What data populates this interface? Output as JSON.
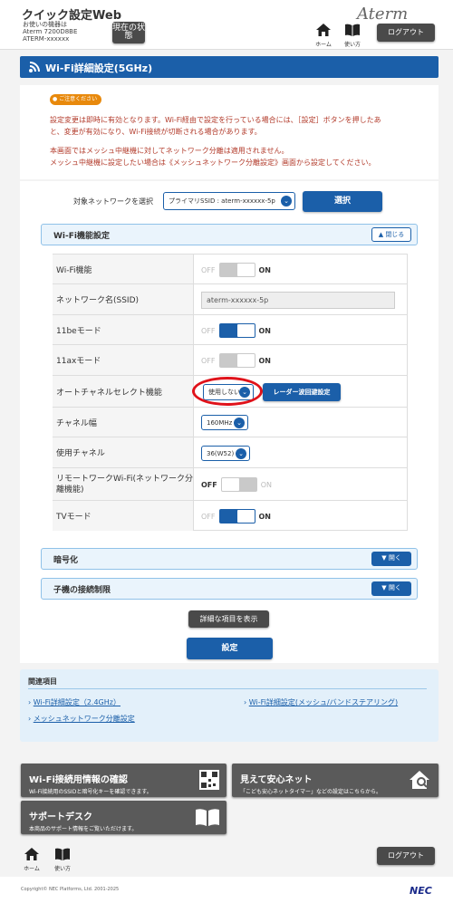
{
  "header": {
    "app_title": "クイック設定Web",
    "device_line1": "お使いの機器は",
    "device_line2": "Aterm 7200D8BE",
    "device_line3": "ATERM-xxxxxx",
    "status_btn": "現在の状態",
    "home_label": "ホーム",
    "howto_label": "使い方",
    "logout_label": "ログアウト",
    "brand": "Aterm"
  },
  "page_title": "Wi-Fi詳細設定(5GHz)",
  "notice": {
    "badge": "ご注意ください",
    "line1": "設定変更は即時に有効となります。Wi-Fi経由で設定を行っている場合には、［設定］ボタンを押したあ",
    "line2": "と、変更が有効になり、Wi-Fi接続が切断される場合があります。",
    "line3": "本画面ではメッシュ中継機に対してネットワーク分離は適用されません。",
    "line4": "メッシュ中継機に設定したい場合は《メッシュネットワーク分離設定》画面から設定してください。"
  },
  "network_select": {
    "label": "対象ネットワークを選択",
    "value": "プライマリSSID : aterm-xxxxxx-5p",
    "button": "選択"
  },
  "wifi_func": {
    "title": "Wi-Fi機能設定",
    "toggle_label": "閉じる",
    "rows": [
      {
        "label": "Wi-Fi機能",
        "off": "OFF",
        "on": "ON"
      },
      {
        "label": "ネットワーク名(SSID)",
        "value": "aterm-xxxxxx-5p"
      },
      {
        "label": "11beモード",
        "off": "OFF",
        "on": "ON"
      },
      {
        "label": "11axモード",
        "off": "OFF",
        "on": "ON"
      },
      {
        "label": "オートチャネルセレクト機能",
        "select": "使用しない",
        "button": "レーダー波回避設定"
      },
      {
        "label": "チャネル幅",
        "select": "160MHz"
      },
      {
        "label": "使用チャネル",
        "select": "36(W52)"
      },
      {
        "label": "リモートワークWi-Fi(ネットワーク分離機能)",
        "off": "OFF",
        "on": "ON"
      },
      {
        "label": "TVモード",
        "off": "OFF",
        "on": "ON"
      }
    ]
  },
  "encryption": {
    "title": "暗号化",
    "toggle_label": "開く"
  },
  "child_limit": {
    "title": "子機の接続制限",
    "toggle_label": "開く"
  },
  "show_details": "詳細な項目を表示",
  "apply": "設定",
  "related": {
    "title": "関連項目",
    "link1": "Wi-Fi詳細設定（2.4GHz）",
    "link2": "Wi-Fi詳細設定(メッシュ/バンドステアリング)",
    "link3": "メッシュネットワーク分離設定"
  },
  "tiles": {
    "t1_title": "Wi-Fi接続用情報の確認",
    "t1_sub": "Wi-Fi接続用のSSIDと暗号化キーを確認できます。",
    "t2_title": "見えて安心ネット",
    "t2_sub": "「こども安心ネットタイマー」などの設定はこちらから。",
    "t3_title": "サポートデスク",
    "t3_sub": "本商品のサポート情報をご覧いただけます。"
  },
  "footer": {
    "home_label": "ホーム",
    "howto_label": "使い方",
    "logout_label": "ログアウト",
    "copyright": "Copyright© NEC Platforms, Ltd. 2001-2025",
    "brand": "NEC"
  },
  "colors": {
    "accent": "#1b5fa9",
    "notice_text": "#b23a2a",
    "badge": "#e8890c",
    "highlight": "#e0121a"
  }
}
